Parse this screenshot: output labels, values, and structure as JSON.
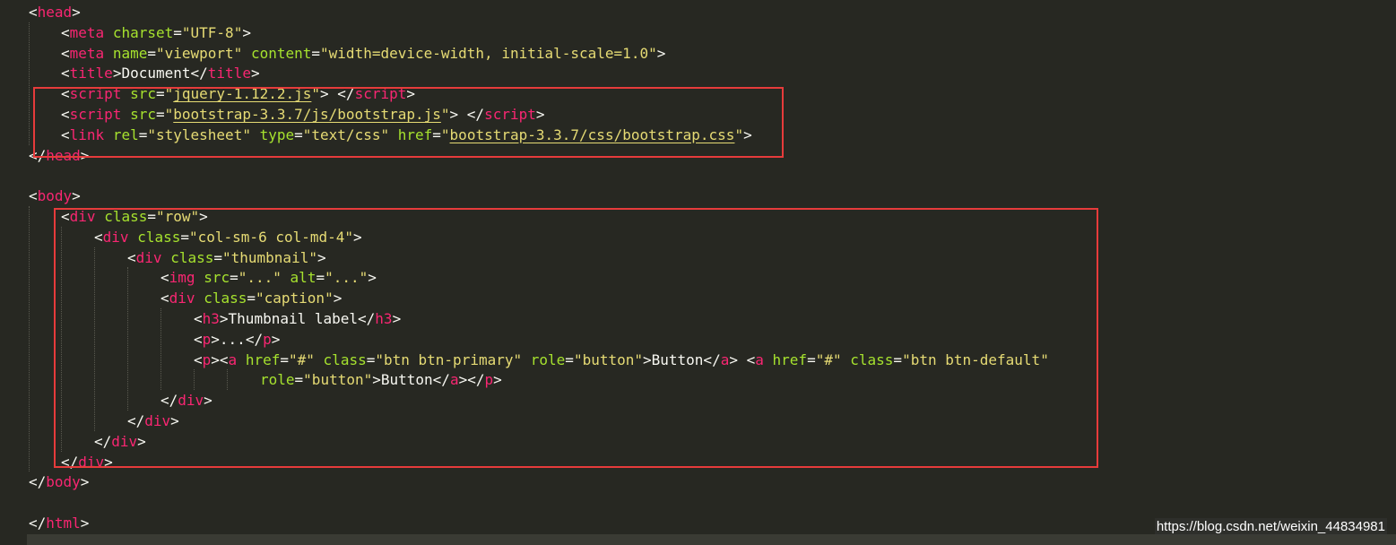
{
  "editor": {
    "theme_colors": {
      "background": "#272822",
      "tag": "#F92672",
      "attribute": "#A6E22E",
      "string": "#E6DB74",
      "text": "#F8F8F2",
      "highlight_box": "#E63B3B"
    },
    "lines": [
      {
        "tokens": [
          {
            "c": "p",
            "t": "<"
          },
          {
            "c": "tag",
            "t": "head"
          },
          {
            "c": "p",
            "t": ">"
          }
        ]
      },
      {
        "tokens": [
          {
            "c": "p",
            "t": "<"
          },
          {
            "c": "tag",
            "t": "meta"
          },
          {
            "c": "p",
            "t": " "
          },
          {
            "c": "attr",
            "t": "charset"
          },
          {
            "c": "p",
            "t": "="
          },
          {
            "c": "str",
            "t": "\"UTF-8\""
          },
          {
            "c": "p",
            "t": ">"
          }
        ]
      },
      {
        "tokens": [
          {
            "c": "p",
            "t": "<"
          },
          {
            "c": "tag",
            "t": "meta"
          },
          {
            "c": "p",
            "t": " "
          },
          {
            "c": "attr",
            "t": "name"
          },
          {
            "c": "p",
            "t": "="
          },
          {
            "c": "str",
            "t": "\"viewport\""
          },
          {
            "c": "p",
            "t": " "
          },
          {
            "c": "attr",
            "t": "content"
          },
          {
            "c": "p",
            "t": "="
          },
          {
            "c": "str",
            "t": "\"width=device-width, initial-scale=1.0\""
          },
          {
            "c": "p",
            "t": ">"
          }
        ]
      },
      {
        "tokens": [
          {
            "c": "p",
            "t": "<"
          },
          {
            "c": "tag",
            "t": "title"
          },
          {
            "c": "p",
            "t": ">Document</"
          },
          {
            "c": "tag",
            "t": "title"
          },
          {
            "c": "p",
            "t": ">"
          }
        ]
      },
      {
        "tokens": [
          {
            "c": "p",
            "t": "<"
          },
          {
            "c": "tag",
            "t": "script"
          },
          {
            "c": "p",
            "t": " "
          },
          {
            "c": "attr",
            "t": "src"
          },
          {
            "c": "p",
            "t": "="
          },
          {
            "c": "str",
            "t": "\""
          },
          {
            "c": "link",
            "t": "jquery-1.12.2.js"
          },
          {
            "c": "str",
            "t": "\""
          },
          {
            "c": "p",
            "t": "> </"
          },
          {
            "c": "tag",
            "t": "script"
          },
          {
            "c": "p",
            "t": ">"
          }
        ]
      },
      {
        "tokens": [
          {
            "c": "p",
            "t": "<"
          },
          {
            "c": "tag",
            "t": "script"
          },
          {
            "c": "p",
            "t": " "
          },
          {
            "c": "attr",
            "t": "src"
          },
          {
            "c": "p",
            "t": "="
          },
          {
            "c": "str",
            "t": "\""
          },
          {
            "c": "link",
            "t": "bootstrap-3.3.7/js/bootstrap.js"
          },
          {
            "c": "str",
            "t": "\""
          },
          {
            "c": "p",
            "t": "> </"
          },
          {
            "c": "tag",
            "t": "script"
          },
          {
            "c": "p",
            "t": ">"
          }
        ]
      },
      {
        "tokens": [
          {
            "c": "p",
            "t": "<"
          },
          {
            "c": "tag",
            "t": "link"
          },
          {
            "c": "p",
            "t": " "
          },
          {
            "c": "attr",
            "t": "rel"
          },
          {
            "c": "p",
            "t": "="
          },
          {
            "c": "str",
            "t": "\"stylesheet\""
          },
          {
            "c": "p",
            "t": " "
          },
          {
            "c": "attr",
            "t": "type"
          },
          {
            "c": "p",
            "t": "="
          },
          {
            "c": "str",
            "t": "\"text/css\""
          },
          {
            "c": "p",
            "t": " "
          },
          {
            "c": "attr",
            "t": "href"
          },
          {
            "c": "p",
            "t": "="
          },
          {
            "c": "str",
            "t": "\""
          },
          {
            "c": "link",
            "t": "bootstrap-3.3.7/css/bootstrap.css"
          },
          {
            "c": "str",
            "t": "\""
          },
          {
            "c": "p",
            "t": ">"
          }
        ]
      },
      {
        "tokens": [
          {
            "c": "p",
            "t": "</"
          },
          {
            "c": "tag",
            "t": "head"
          },
          {
            "c": "p",
            "t": ">"
          }
        ]
      },
      {
        "tokens": []
      },
      {
        "tokens": [
          {
            "c": "p",
            "t": "<"
          },
          {
            "c": "tag",
            "t": "body"
          },
          {
            "c": "p",
            "t": ">"
          }
        ]
      },
      {
        "tokens": [
          {
            "c": "p",
            "t": "<"
          },
          {
            "c": "tag",
            "t": "div"
          },
          {
            "c": "p",
            "t": " "
          },
          {
            "c": "attr",
            "t": "class"
          },
          {
            "c": "p",
            "t": "="
          },
          {
            "c": "str",
            "t": "\"row\""
          },
          {
            "c": "p",
            "t": ">"
          }
        ]
      },
      {
        "tokens": [
          {
            "c": "p",
            "t": "<"
          },
          {
            "c": "tag",
            "t": "div"
          },
          {
            "c": "p",
            "t": " "
          },
          {
            "c": "attr",
            "t": "class"
          },
          {
            "c": "p",
            "t": "="
          },
          {
            "c": "str",
            "t": "\"col-sm-6 col-md-4\""
          },
          {
            "c": "p",
            "t": ">"
          }
        ]
      },
      {
        "tokens": [
          {
            "c": "p",
            "t": "<"
          },
          {
            "c": "tag",
            "t": "div"
          },
          {
            "c": "p",
            "t": " "
          },
          {
            "c": "attr",
            "t": "class"
          },
          {
            "c": "p",
            "t": "="
          },
          {
            "c": "str",
            "t": "\"thumbnail\""
          },
          {
            "c": "p",
            "t": ">"
          }
        ]
      },
      {
        "tokens": [
          {
            "c": "p",
            "t": "<"
          },
          {
            "c": "tag",
            "t": "img"
          },
          {
            "c": "p",
            "t": " "
          },
          {
            "c": "attr",
            "t": "src"
          },
          {
            "c": "p",
            "t": "="
          },
          {
            "c": "str",
            "t": "\"...\""
          },
          {
            "c": "p",
            "t": " "
          },
          {
            "c": "attr",
            "t": "alt"
          },
          {
            "c": "p",
            "t": "="
          },
          {
            "c": "str",
            "t": "\"...\""
          },
          {
            "c": "p",
            "t": ">"
          }
        ]
      },
      {
        "tokens": [
          {
            "c": "p",
            "t": "<"
          },
          {
            "c": "tag",
            "t": "div"
          },
          {
            "c": "p",
            "t": " "
          },
          {
            "c": "attr",
            "t": "class"
          },
          {
            "c": "p",
            "t": "="
          },
          {
            "c": "str",
            "t": "\"caption\""
          },
          {
            "c": "p",
            "t": ">"
          }
        ]
      },
      {
        "tokens": [
          {
            "c": "p",
            "t": "<"
          },
          {
            "c": "tag",
            "t": "h3"
          },
          {
            "c": "p",
            "t": ">Thumbnail label</"
          },
          {
            "c": "tag",
            "t": "h3"
          },
          {
            "c": "p",
            "t": ">"
          }
        ]
      },
      {
        "tokens": [
          {
            "c": "p",
            "t": "<"
          },
          {
            "c": "tag",
            "t": "p"
          },
          {
            "c": "p",
            "t": ">...</"
          },
          {
            "c": "tag",
            "t": "p"
          },
          {
            "c": "p",
            "t": ">"
          }
        ]
      },
      {
        "tokens": [
          {
            "c": "p",
            "t": "<"
          },
          {
            "c": "tag",
            "t": "p"
          },
          {
            "c": "p",
            "t": "><"
          },
          {
            "c": "tag",
            "t": "a"
          },
          {
            "c": "p",
            "t": " "
          },
          {
            "c": "attr",
            "t": "href"
          },
          {
            "c": "p",
            "t": "="
          },
          {
            "c": "str",
            "t": "\"#\""
          },
          {
            "c": "p",
            "t": " "
          },
          {
            "c": "attr",
            "t": "class"
          },
          {
            "c": "p",
            "t": "="
          },
          {
            "c": "str",
            "t": "\"btn btn-primary\""
          },
          {
            "c": "p",
            "t": " "
          },
          {
            "c": "attr",
            "t": "role"
          },
          {
            "c": "p",
            "t": "="
          },
          {
            "c": "str",
            "t": "\"button\""
          },
          {
            "c": "p",
            "t": ">Button</"
          },
          {
            "c": "tag",
            "t": "a"
          },
          {
            "c": "p",
            "t": "> <"
          },
          {
            "c": "tag",
            "t": "a"
          },
          {
            "c": "p",
            "t": " "
          },
          {
            "c": "attr",
            "t": "href"
          },
          {
            "c": "p",
            "t": "="
          },
          {
            "c": "str",
            "t": "\"#\""
          },
          {
            "c": "p",
            "t": " "
          },
          {
            "c": "attr",
            "t": "class"
          },
          {
            "c": "p",
            "t": "="
          },
          {
            "c": "str",
            "t": "\"btn btn-default\""
          }
        ]
      },
      {
        "tokens": [
          {
            "c": "attr",
            "t": "role"
          },
          {
            "c": "p",
            "t": "="
          },
          {
            "c": "str",
            "t": "\"button\""
          },
          {
            "c": "p",
            "t": ">Button</"
          },
          {
            "c": "tag",
            "t": "a"
          },
          {
            "c": "p",
            "t": "></"
          },
          {
            "c": "tag",
            "t": "p"
          },
          {
            "c": "p",
            "t": ">"
          }
        ]
      },
      {
        "tokens": [
          {
            "c": "p",
            "t": "</"
          },
          {
            "c": "tag",
            "t": "div"
          },
          {
            "c": "p",
            "t": ">"
          }
        ]
      },
      {
        "tokens": [
          {
            "c": "p",
            "t": "</"
          },
          {
            "c": "tag",
            "t": "div"
          },
          {
            "c": "p",
            "t": ">"
          }
        ]
      },
      {
        "tokens": [
          {
            "c": "p",
            "t": "</"
          },
          {
            "c": "tag",
            "t": "div"
          },
          {
            "c": "p",
            "t": ">"
          }
        ]
      },
      {
        "tokens": [
          {
            "c": "p",
            "t": "</"
          },
          {
            "c": "tag",
            "t": "div"
          },
          {
            "c": "p",
            "t": ">"
          }
        ]
      },
      {
        "tokens": [
          {
            "c": "p",
            "t": "</"
          },
          {
            "c": "tag",
            "t": "body"
          },
          {
            "c": "p",
            "t": ">"
          }
        ]
      },
      {
        "tokens": []
      },
      {
        "tokens": [
          {
            "c": "p",
            "t": "</"
          },
          {
            "c": "tag",
            "t": "html"
          },
          {
            "c": "p",
            "t": ">"
          }
        ]
      }
    ]
  },
  "watermark": "https://blog.csdn.net/weixin_44834981"
}
